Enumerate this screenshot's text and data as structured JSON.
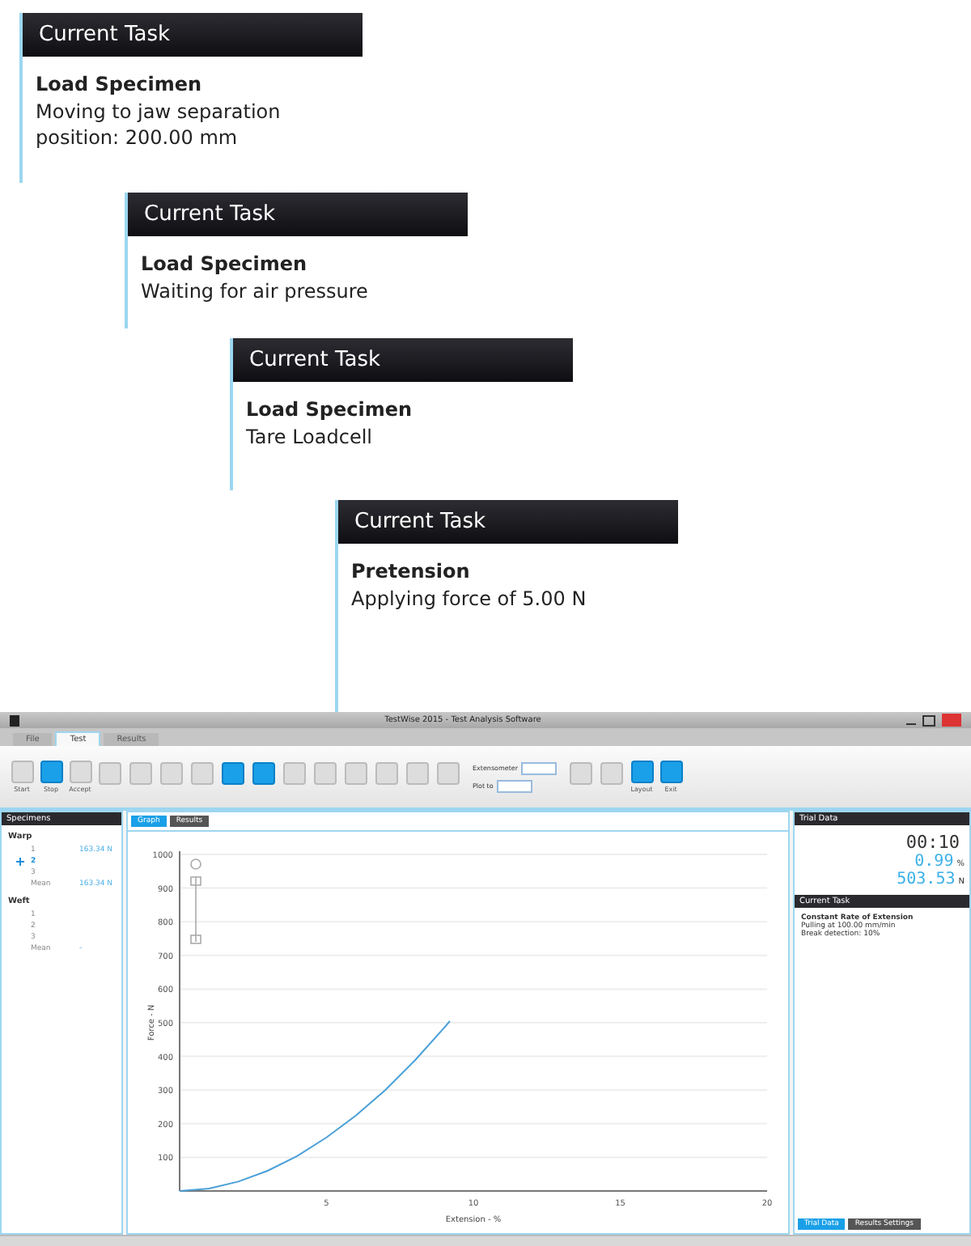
{
  "task_panels": [
    {
      "title": "Current Task",
      "step": "Load Specimen",
      "detail": "Moving to jaw separation position: 200.00 mm"
    },
    {
      "title": "Current Task",
      "step": "Load Specimen",
      "detail": "Waiting for air pressure"
    },
    {
      "title": "Current Task",
      "step": "Load Specimen",
      "detail": "Tare Loadcell"
    },
    {
      "title": "Current Task",
      "step": "Pretension",
      "detail": "Applying force of 5.00 N"
    }
  ],
  "app": {
    "window": {
      "title": "TestWise 2015 - Test Analysis Software"
    },
    "ribbon_tabs": [
      {
        "label": "File",
        "selected": false
      },
      {
        "label": "Test",
        "selected": true
      },
      {
        "label": "Results",
        "selected": false
      }
    ],
    "ribbon_buttons": [
      {
        "label": "Start",
        "active": false
      },
      {
        "label": "Stop",
        "active": true
      },
      {
        "label": "Accept",
        "active": false
      },
      {
        "active": false
      },
      {
        "active": false
      },
      {
        "active": false
      },
      {
        "active": false
      },
      {
        "active": true
      },
      {
        "active": true
      },
      {
        "active": false
      },
      {
        "active": false
      },
      {
        "active": false
      },
      {
        "active": false
      },
      {
        "active": false
      },
      {
        "active": false
      }
    ],
    "ribbon_fields": [
      {
        "label": "Extensometer"
      },
      {
        "label": "Plot to"
      }
    ],
    "ribbon_buttons_end": [
      {
        "active": false
      },
      {
        "active": false
      },
      {
        "label": "Layout",
        "active": true
      },
      {
        "label": "Exit",
        "active": true
      }
    ],
    "specimens": {
      "title": "Specimens",
      "groups": [
        {
          "name": "Warp",
          "rows": [
            {
              "name": "1",
              "value": "163.34 N",
              "selected": false
            },
            {
              "name": "2",
              "selected": true
            },
            {
              "name": "3",
              "selected": false
            },
            {
              "name": "Mean",
              "value": "163.34 N",
              "selected": false
            }
          ]
        },
        {
          "name": "Weft",
          "rows": [
            {
              "name": "1",
              "selected": false
            },
            {
              "name": "2",
              "selected": false
            },
            {
              "name": "3",
              "selected": false
            },
            {
              "name": "Mean",
              "value": "-",
              "selected": false
            }
          ]
        }
      ]
    },
    "view_tabs": [
      {
        "label": "Graph",
        "selected": true
      },
      {
        "label": "Results",
        "selected": false
      }
    ],
    "chart_data": {
      "type": "line",
      "xlabel": "Extension - %",
      "ylabel": "Force - N",
      "xlim": [
        0,
        20
      ],
      "ylim": [
        0,
        1000
      ],
      "xticks": [
        5,
        10,
        15,
        20
      ],
      "yticks": [
        100,
        200,
        300,
        400,
        500,
        600,
        700,
        800,
        900,
        1000
      ],
      "x": [
        0,
        1,
        2,
        3,
        4,
        5,
        6,
        7,
        8,
        9,
        9.2
      ],
      "grid": true,
      "series": [
        {
          "color": "#4a9fd8",
          "values": [
            0,
            7,
            28,
            60,
            104,
            159,
            224,
            300,
            387,
            484,
            505
          ]
        }
      ]
    },
    "trial_data": {
      "title": "Trial Data",
      "time": "00:10",
      "readings": [
        {
          "value": "0.99",
          "unit": "%"
        },
        {
          "value": "503.53",
          "unit": "N"
        }
      ]
    },
    "current_task": {
      "title": "Current Task",
      "step": "Constant Rate of Extension",
      "lines": [
        "Pulling at 100.00 mm/min",
        "Break detection: 10%"
      ]
    },
    "bottom_tabs": [
      {
        "label": "Trial Data",
        "selected": true
      },
      {
        "label": "Results Settings",
        "selected": false
      }
    ]
  }
}
